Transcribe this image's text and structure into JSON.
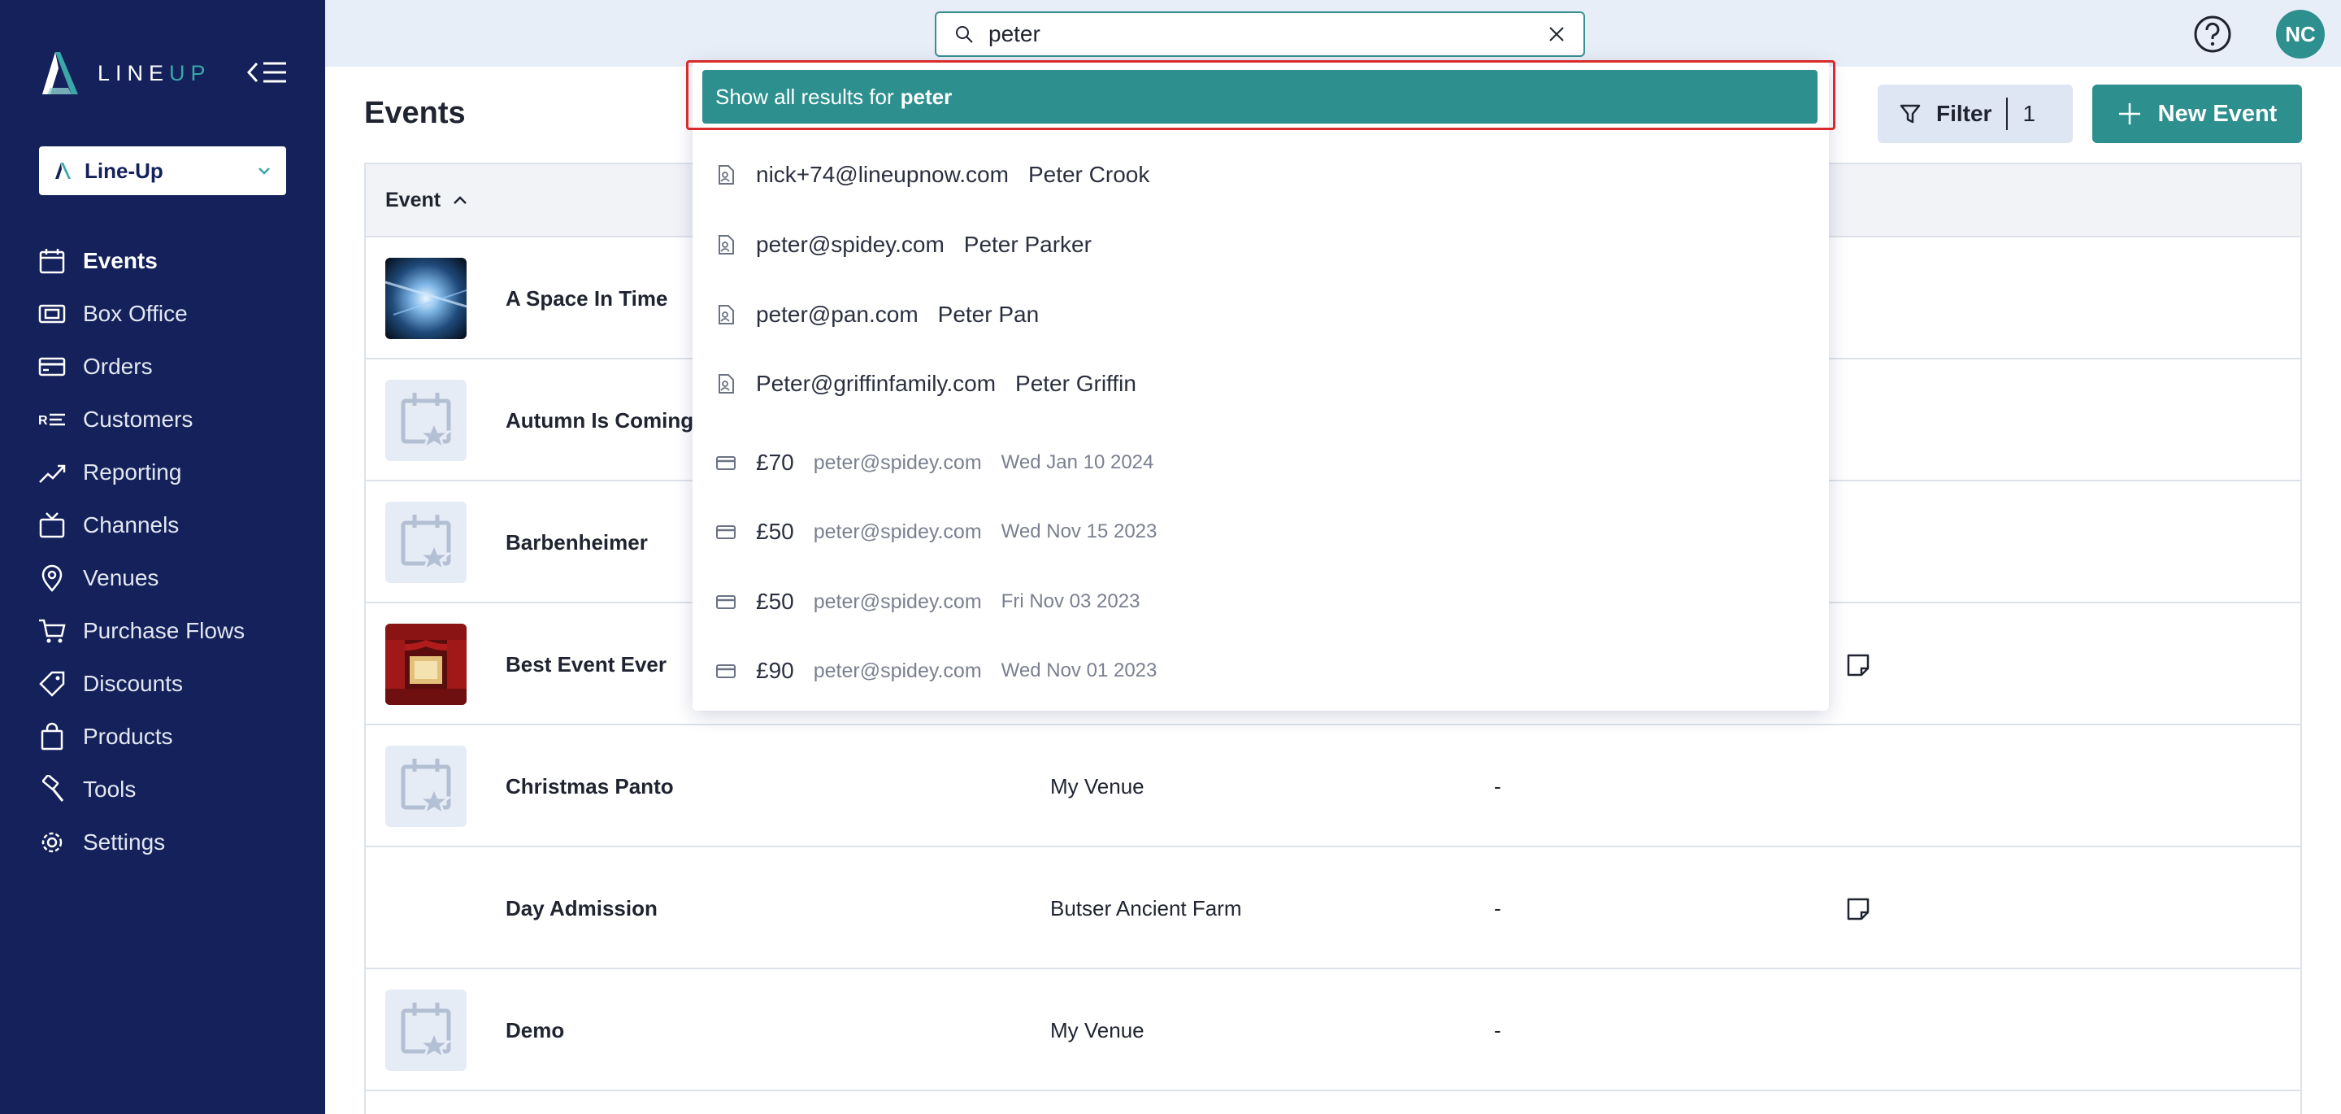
{
  "sidebar": {
    "logo": {
      "part1": "LINE",
      "part2": "UP"
    },
    "org_select": "Line-Up",
    "items": [
      {
        "label": "Events",
        "icon": "calendar-icon",
        "active": true
      },
      {
        "label": "Box Office",
        "icon": "ticket-icon"
      },
      {
        "label": "Orders",
        "icon": "credit-card-icon"
      },
      {
        "label": "Customers",
        "icon": "contacts-list-icon"
      },
      {
        "label": "Reporting",
        "icon": "trending-chart-icon"
      },
      {
        "label": "Channels",
        "icon": "tv-icon"
      },
      {
        "label": "Venues",
        "icon": "map-pin-icon"
      },
      {
        "label": "Purchase Flows",
        "icon": "cart-icon"
      },
      {
        "label": "Discounts",
        "icon": "tag-icon"
      },
      {
        "label": "Products",
        "icon": "shopping-bag-icon"
      },
      {
        "label": "Tools",
        "icon": "hammer-icon"
      },
      {
        "label": "Settings",
        "icon": "gear-icon"
      }
    ]
  },
  "topbar": {
    "search_value": "peter",
    "avatar_initials": "NC"
  },
  "main": {
    "title": "Events",
    "filter_label": "Filter",
    "filter_count": "1",
    "new_event_label": "New Event",
    "table_header": "Event",
    "rows": [
      {
        "name": "A Space In Time",
        "venue": "",
        "dash": "",
        "thumb": "space-image"
      },
      {
        "name": "Autumn Is Coming",
        "venue": "",
        "dash": "",
        "thumb": "placeholder"
      },
      {
        "name": "Barbenheimer",
        "venue": "",
        "dash": "",
        "thumb": "placeholder"
      },
      {
        "name": "Best Event Ever",
        "venue": "",
        "dash": "",
        "thumb": "theatre-image",
        "note": true
      },
      {
        "name": "Christmas Panto",
        "venue": "My Venue",
        "dash": "-",
        "thumb": "placeholder"
      },
      {
        "name": "Day Admission",
        "venue": "Butser Ancient Farm",
        "dash": "-",
        "thumb": "blank",
        "note": true
      },
      {
        "name": "Demo",
        "venue": "My Venue",
        "dash": "-",
        "thumb": "placeholder"
      }
    ]
  },
  "dropdown": {
    "show_all_prefix": "Show all results for",
    "show_all_query": "peter",
    "customers": [
      {
        "email": "nick+74@lineupnow.com",
        "name": "Peter Crook"
      },
      {
        "email": "peter@spidey.com",
        "name": "Peter Parker"
      },
      {
        "email": "peter@pan.com",
        "name": "Peter Pan"
      },
      {
        "email": "Peter@griffinfamily.com",
        "name": "Peter Griffin"
      }
    ],
    "orders": [
      {
        "amount": "£70",
        "email": "peter@spidey.com",
        "date": "Wed Jan 10 2024"
      },
      {
        "amount": "£50",
        "email": "peter@spidey.com",
        "date": "Wed Nov 15 2023"
      },
      {
        "amount": "£50",
        "email": "peter@spidey.com",
        "date": "Fri Nov 03 2023"
      },
      {
        "amount": "£90",
        "email": "peter@spidey.com",
        "date": "Wed Nov 01 2023"
      }
    ]
  },
  "colors": {
    "sidebar": "#14215a",
    "accent": "#2e8f8f",
    "highlight": "#d92b2b"
  }
}
